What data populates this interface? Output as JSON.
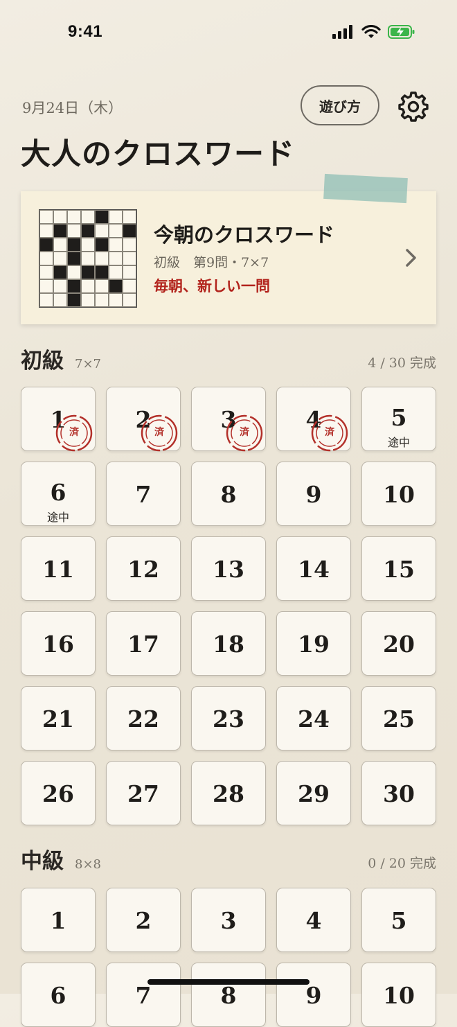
{
  "status_bar": {
    "time": "9:41",
    "icons": [
      "cellular-icon",
      "wifi-icon",
      "battery-charging-icon"
    ]
  },
  "header": {
    "date": "9月24日（木）",
    "howto_label": "遊び方",
    "title": "大人のクロスワード"
  },
  "hero": {
    "title": "今朝のクロスワード",
    "meta": "初級　第9問・7×7",
    "tagline": "毎朝、新しい一問",
    "grid_pattern": [
      "0000100",
      "0101001",
      "1010100",
      "0010000",
      "0101100",
      "0010010",
      "0010000"
    ]
  },
  "sections": [
    {
      "name": "初級",
      "size": "7×7",
      "progress": "4 / 30 完成",
      "levels": [
        {
          "n": "1",
          "status": "done"
        },
        {
          "n": "2",
          "status": "done"
        },
        {
          "n": "3",
          "status": "done"
        },
        {
          "n": "4",
          "status": "done"
        },
        {
          "n": "5",
          "status": "inprogress"
        },
        {
          "n": "6",
          "status": "inprogress"
        },
        {
          "n": "7",
          "status": ""
        },
        {
          "n": "8",
          "status": ""
        },
        {
          "n": "9",
          "status": ""
        },
        {
          "n": "10",
          "status": ""
        },
        {
          "n": "11",
          "status": ""
        },
        {
          "n": "12",
          "status": ""
        },
        {
          "n": "13",
          "status": ""
        },
        {
          "n": "14",
          "status": ""
        },
        {
          "n": "15",
          "status": ""
        },
        {
          "n": "16",
          "status": ""
        },
        {
          "n": "17",
          "status": ""
        },
        {
          "n": "18",
          "status": ""
        },
        {
          "n": "19",
          "status": ""
        },
        {
          "n": "20",
          "status": ""
        },
        {
          "n": "21",
          "status": ""
        },
        {
          "n": "22",
          "status": ""
        },
        {
          "n": "23",
          "status": ""
        },
        {
          "n": "24",
          "status": ""
        },
        {
          "n": "25",
          "status": ""
        },
        {
          "n": "26",
          "status": ""
        },
        {
          "n": "27",
          "status": ""
        },
        {
          "n": "28",
          "status": ""
        },
        {
          "n": "29",
          "status": ""
        },
        {
          "n": "30",
          "status": ""
        }
      ]
    },
    {
      "name": "中級",
      "size": "8×8",
      "progress": "0 / 20 完成",
      "levels": [
        {
          "n": "1",
          "status": ""
        },
        {
          "n": "2",
          "status": ""
        },
        {
          "n": "3",
          "status": ""
        },
        {
          "n": "4",
          "status": ""
        },
        {
          "n": "5",
          "status": ""
        },
        {
          "n": "6",
          "status": ""
        },
        {
          "n": "7",
          "status": ""
        },
        {
          "n": "8",
          "status": ""
        },
        {
          "n": "9",
          "status": ""
        },
        {
          "n": "10",
          "status": ""
        }
      ]
    }
  ],
  "labels": {
    "done_stamp": "済",
    "in_progress": "途中"
  },
  "colors": {
    "accent_red": "#b2231c",
    "paper": "#eee8db",
    "tape": "#8cbcb4"
  }
}
